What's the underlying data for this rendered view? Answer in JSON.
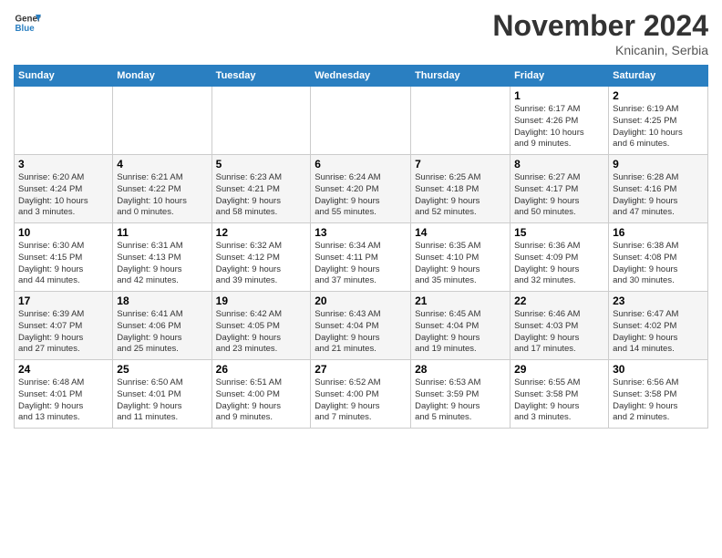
{
  "header": {
    "logo_general": "General",
    "logo_blue": "Blue",
    "month_title": "November 2024",
    "location": "Knicanin, Serbia"
  },
  "weekdays": [
    "Sunday",
    "Monday",
    "Tuesday",
    "Wednesday",
    "Thursday",
    "Friday",
    "Saturday"
  ],
  "weeks": [
    [
      {
        "day": "",
        "info": ""
      },
      {
        "day": "",
        "info": ""
      },
      {
        "day": "",
        "info": ""
      },
      {
        "day": "",
        "info": ""
      },
      {
        "day": "",
        "info": ""
      },
      {
        "day": "1",
        "info": "Sunrise: 6:17 AM\nSunset: 4:26 PM\nDaylight: 10 hours\nand 9 minutes."
      },
      {
        "day": "2",
        "info": "Sunrise: 6:19 AM\nSunset: 4:25 PM\nDaylight: 10 hours\nand 6 minutes."
      }
    ],
    [
      {
        "day": "3",
        "info": "Sunrise: 6:20 AM\nSunset: 4:24 PM\nDaylight: 10 hours\nand 3 minutes."
      },
      {
        "day": "4",
        "info": "Sunrise: 6:21 AM\nSunset: 4:22 PM\nDaylight: 10 hours\nand 0 minutes."
      },
      {
        "day": "5",
        "info": "Sunrise: 6:23 AM\nSunset: 4:21 PM\nDaylight: 9 hours\nand 58 minutes."
      },
      {
        "day": "6",
        "info": "Sunrise: 6:24 AM\nSunset: 4:20 PM\nDaylight: 9 hours\nand 55 minutes."
      },
      {
        "day": "7",
        "info": "Sunrise: 6:25 AM\nSunset: 4:18 PM\nDaylight: 9 hours\nand 52 minutes."
      },
      {
        "day": "8",
        "info": "Sunrise: 6:27 AM\nSunset: 4:17 PM\nDaylight: 9 hours\nand 50 minutes."
      },
      {
        "day": "9",
        "info": "Sunrise: 6:28 AM\nSunset: 4:16 PM\nDaylight: 9 hours\nand 47 minutes."
      }
    ],
    [
      {
        "day": "10",
        "info": "Sunrise: 6:30 AM\nSunset: 4:15 PM\nDaylight: 9 hours\nand 44 minutes."
      },
      {
        "day": "11",
        "info": "Sunrise: 6:31 AM\nSunset: 4:13 PM\nDaylight: 9 hours\nand 42 minutes."
      },
      {
        "day": "12",
        "info": "Sunrise: 6:32 AM\nSunset: 4:12 PM\nDaylight: 9 hours\nand 39 minutes."
      },
      {
        "day": "13",
        "info": "Sunrise: 6:34 AM\nSunset: 4:11 PM\nDaylight: 9 hours\nand 37 minutes."
      },
      {
        "day": "14",
        "info": "Sunrise: 6:35 AM\nSunset: 4:10 PM\nDaylight: 9 hours\nand 35 minutes."
      },
      {
        "day": "15",
        "info": "Sunrise: 6:36 AM\nSunset: 4:09 PM\nDaylight: 9 hours\nand 32 minutes."
      },
      {
        "day": "16",
        "info": "Sunrise: 6:38 AM\nSunset: 4:08 PM\nDaylight: 9 hours\nand 30 minutes."
      }
    ],
    [
      {
        "day": "17",
        "info": "Sunrise: 6:39 AM\nSunset: 4:07 PM\nDaylight: 9 hours\nand 27 minutes."
      },
      {
        "day": "18",
        "info": "Sunrise: 6:41 AM\nSunset: 4:06 PM\nDaylight: 9 hours\nand 25 minutes."
      },
      {
        "day": "19",
        "info": "Sunrise: 6:42 AM\nSunset: 4:05 PM\nDaylight: 9 hours\nand 23 minutes."
      },
      {
        "day": "20",
        "info": "Sunrise: 6:43 AM\nSunset: 4:04 PM\nDaylight: 9 hours\nand 21 minutes."
      },
      {
        "day": "21",
        "info": "Sunrise: 6:45 AM\nSunset: 4:04 PM\nDaylight: 9 hours\nand 19 minutes."
      },
      {
        "day": "22",
        "info": "Sunrise: 6:46 AM\nSunset: 4:03 PM\nDaylight: 9 hours\nand 17 minutes."
      },
      {
        "day": "23",
        "info": "Sunrise: 6:47 AM\nSunset: 4:02 PM\nDaylight: 9 hours\nand 14 minutes."
      }
    ],
    [
      {
        "day": "24",
        "info": "Sunrise: 6:48 AM\nSunset: 4:01 PM\nDaylight: 9 hours\nand 13 minutes."
      },
      {
        "day": "25",
        "info": "Sunrise: 6:50 AM\nSunset: 4:01 PM\nDaylight: 9 hours\nand 11 minutes."
      },
      {
        "day": "26",
        "info": "Sunrise: 6:51 AM\nSunset: 4:00 PM\nDaylight: 9 hours\nand 9 minutes."
      },
      {
        "day": "27",
        "info": "Sunrise: 6:52 AM\nSunset: 4:00 PM\nDaylight: 9 hours\nand 7 minutes."
      },
      {
        "day": "28",
        "info": "Sunrise: 6:53 AM\nSunset: 3:59 PM\nDaylight: 9 hours\nand 5 minutes."
      },
      {
        "day": "29",
        "info": "Sunrise: 6:55 AM\nSunset: 3:58 PM\nDaylight: 9 hours\nand 3 minutes."
      },
      {
        "day": "30",
        "info": "Sunrise: 6:56 AM\nSunset: 3:58 PM\nDaylight: 9 hours\nand 2 minutes."
      }
    ]
  ]
}
